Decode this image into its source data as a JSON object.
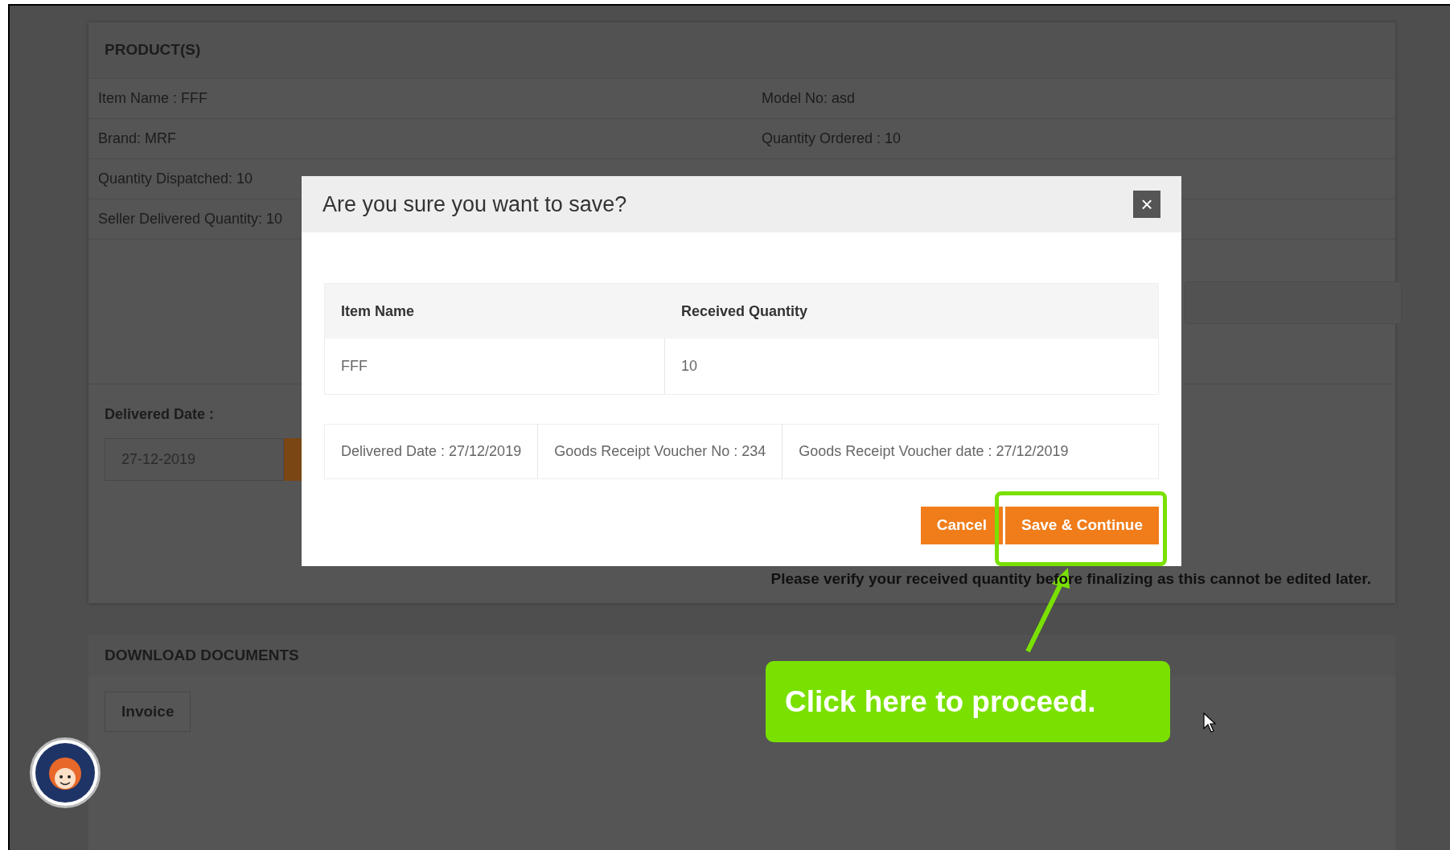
{
  "products": {
    "title": "PRODUCT(S)",
    "rows": [
      {
        "left": "Item Name : FFF",
        "right": "Model No: asd"
      },
      {
        "left": "Brand: MRF",
        "right": "Quantity Ordered : 10"
      },
      {
        "left": "Quantity Dispatched: 10"
      },
      {
        "left": "Seller Delivered Quantity: 10"
      }
    ]
  },
  "delivered_date": {
    "label": "Delivered Date :",
    "value": "27-12-2019"
  },
  "note": "Please verify your received quantity before finalizing as this cannot be edited later.",
  "documents": {
    "title": "DOWNLOAD DOCUMENTS",
    "buttons": [
      "Invoice"
    ]
  },
  "dialog": {
    "title": "Are you sure you want to save?",
    "close": "×",
    "table": {
      "columns": [
        "Item Name",
        "Received Quantity"
      ],
      "rows": [
        [
          "FFF",
          "10"
        ]
      ]
    },
    "details": [
      "Delivered Date : 27/12/2019",
      "Goods Receipt Voucher No : 234",
      "Goods Receipt Voucher date : 27/12/2019"
    ],
    "buttons": [
      {
        "label": "Cancel",
        "highlighted": false
      },
      {
        "label": "Save & Continue",
        "highlighted": true
      }
    ]
  },
  "callout": {
    "text": "Click here to proceed."
  }
}
